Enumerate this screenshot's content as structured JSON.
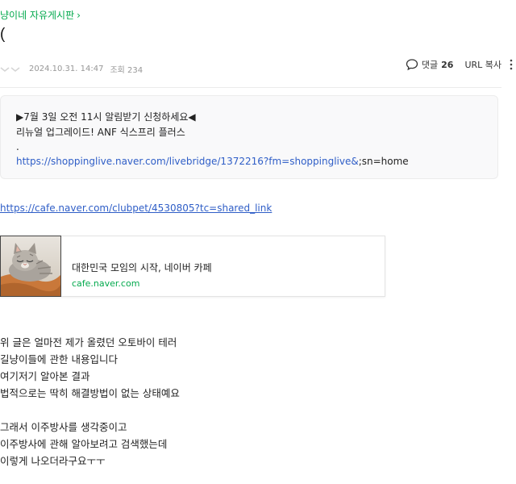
{
  "board": {
    "name": "냥이네 자유게시판",
    "chevron": "›"
  },
  "post": {
    "title": "(",
    "date": "2024.10.31. 14:47",
    "views": "조회 234"
  },
  "actions": {
    "comment_label": "댓글",
    "comment_count": "26",
    "url_copy": "URL 복사",
    "comment_icon": "speech-bubble-icon",
    "more_icon": "vertical-dots-icon"
  },
  "quote": {
    "line1": "▶7월 3일 오전 11시 알림받기 신청하세요◀",
    "line2": "리뉴얼 업그레이드! ANF 식스프리 플러스",
    "line3": ".",
    "link": "https://shoppinglive.naver.com/livebridge/1372216?fm=shoppinglive&",
    "link_suffix": ";sn=home"
  },
  "external_link": "https://cafe.naver.com/clubpet/4530805?tc=shared_link",
  "og_card": {
    "title": "대한민국 모임의 시작, 네이버 카페",
    "domain": "cafe.naver.com",
    "thumb": "cat-photo"
  },
  "body": {
    "p1": [
      "위 글은 얼마전 제가 올렸던 오토바이 테러",
      "길냥이들에 관한 내용입니다",
      "여기저기 알아본 결과",
      "법적으로는 딱히 해결방법이 없는 상태예요"
    ],
    "p2": [
      "그래서 이주방사를 생각중이고",
      "이주방사에 관해 알아보려고 검색했는데",
      "이렇게 나오더라구요ㅜㅜ"
    ]
  },
  "colors": {
    "green": "#03a94d",
    "link": "#2f5ec7"
  }
}
